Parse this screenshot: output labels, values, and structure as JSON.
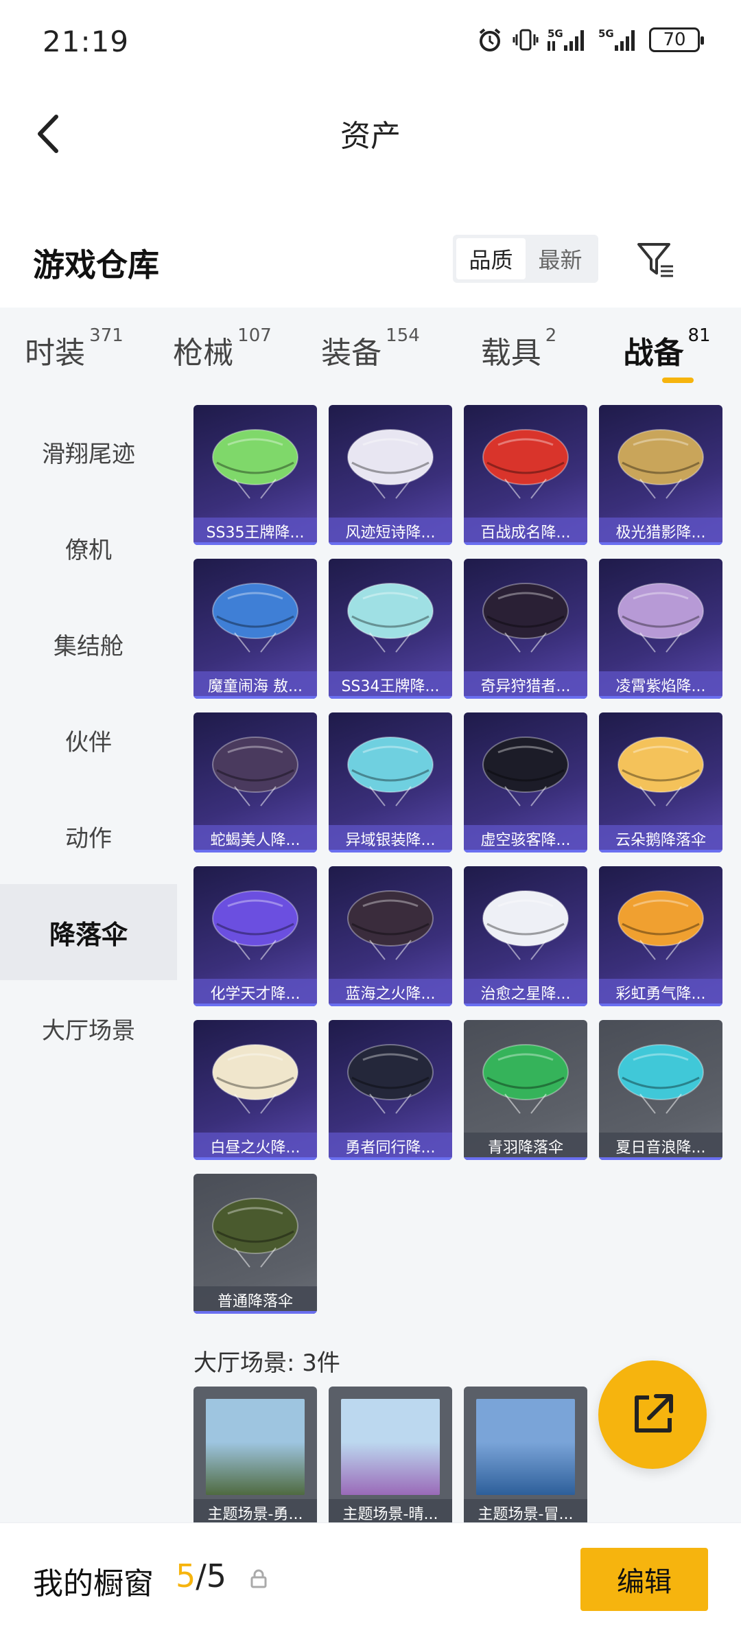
{
  "status_bar": {
    "time": "21:19",
    "battery": "70",
    "net1": "5G",
    "net2": "5G"
  },
  "header": {
    "title": "资产"
  },
  "warehouse": {
    "title": "游戏仓库",
    "sort_options": [
      "品质",
      "最新"
    ],
    "active_sort": "品质"
  },
  "category_tabs": [
    {
      "label": "时装",
      "count": "371"
    },
    {
      "label": "枪械",
      "count": "107"
    },
    {
      "label": "装备",
      "count": "154"
    },
    {
      "label": "载具",
      "count": "2"
    },
    {
      "label": "战备",
      "count": "81"
    }
  ],
  "active_category": "战备",
  "sidebar": {
    "items": [
      "滑翔尾迹",
      "僚机",
      "集结舱",
      "伙伴",
      "动作",
      "降落伞",
      "大厅场景"
    ],
    "active": "降落伞"
  },
  "parachutes": [
    {
      "name": "SS35王牌降...",
      "style": "purple",
      "color": "#7fd86a"
    },
    {
      "name": "风迹短诗降...",
      "style": "purple",
      "color": "#e8e6f2"
    },
    {
      "name": "百战成名降...",
      "style": "purple",
      "color": "#d9342b"
    },
    {
      "name": "极光猎影降...",
      "style": "purple",
      "color": "#c9a55a"
    },
    {
      "name": "魔童闹海 敖...",
      "style": "purple",
      "color": "#3f7fd6"
    },
    {
      "name": "SS34王牌降...",
      "style": "purple",
      "color": "#9fe0e4"
    },
    {
      "name": "奇异狩猎者...",
      "style": "purple",
      "color": "#2a2035"
    },
    {
      "name": "凌霄紫焰降...",
      "style": "purple",
      "color": "#b79ad6"
    },
    {
      "name": "蛇蝎美人降...",
      "style": "purple",
      "color": "#4a3a5e"
    },
    {
      "name": "异域银装降...",
      "style": "purple",
      "color": "#6fd0e0"
    },
    {
      "name": "虚空骇客降...",
      "style": "purple",
      "color": "#1c1c28"
    },
    {
      "name": "云朵鹅降落伞",
      "style": "purple",
      "color": "#f4c25a"
    },
    {
      "name": "化学天才降...",
      "style": "purple",
      "color": "#6b4fe0"
    },
    {
      "name": "蓝海之火降...",
      "style": "purple",
      "color": "#3a2c3c"
    },
    {
      "name": "治愈之星降...",
      "style": "purple",
      "color": "#eef0f6"
    },
    {
      "name": "彩虹勇气降...",
      "style": "purple",
      "color": "#f0a030"
    },
    {
      "name": "白昼之火降...",
      "style": "purple",
      "color": "#f0e6cc"
    },
    {
      "name": "勇者同行降...",
      "style": "purple",
      "color": "#24273a"
    },
    {
      "name": "青羽降落伞",
      "style": "gray",
      "color": "#35b35a"
    },
    {
      "name": "夏日音浪降...",
      "style": "gray",
      "color": "#40c8d8"
    },
    {
      "name": "普通降落伞",
      "style": "gray",
      "color": "#4a5a2e"
    }
  ],
  "lobby_section": {
    "title": "大厅场景: 3件"
  },
  "scenes": [
    {
      "name": "主题场景-勇...",
      "sky": "#9ec5e0",
      "ground": "#4f6a40"
    },
    {
      "name": "主题场景-晴...",
      "sky": "#bcd8ef",
      "ground": "#9a6ab8"
    },
    {
      "name": "主题场景-冒...",
      "sky": "#7aa4d8",
      "ground": "#2e5f9a"
    }
  ],
  "footer": {
    "label": "我的橱窗",
    "current": "5",
    "separator": "/",
    "total": "5",
    "edit_label": "编辑"
  }
}
